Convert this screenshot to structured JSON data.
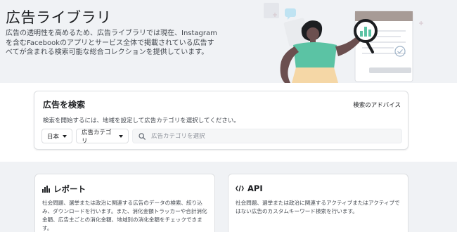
{
  "hero": {
    "title": "広告ライブラリ",
    "description": "広告の透明性を高めるため、広告ライブラリでは現在、Instagramを含むFacebookのアプリとサービス全体で掲載されている広告すべてが含まれる検索可能な総合コレクションを提供しています。"
  },
  "search": {
    "title": "広告を検索",
    "advice_link": "検索のアドバイス",
    "instruction": "検索を開始するには、地域を設定して広告カテゴリを選択してください。",
    "country": "日本",
    "category": "広告カテゴリ",
    "placeholder": "広告カテゴリを選択"
  },
  "cards": {
    "report": {
      "title": "レポート",
      "text": "社会問題、選挙または政治に関連する広告のデータの検索、絞り込み、ダウンロードを行います。また、消化金額トラッカーや合計消化金額、広告主ごとの消化金額、地域別の消化金額をチェックできます。"
    },
    "api": {
      "title": "API",
      "text": "社会問題、選挙または政治に関連するアクティブまたはアクティブではない広告のカスタムキーワード検索を行います。"
    }
  },
  "icons": [
    "bar-chart-icon",
    "code-icon",
    "search-icon",
    "magnifier-icon",
    "check-icon",
    "chat-bubble-icon"
  ],
  "colors": {
    "accent_teal": "#5bc3a4",
    "skin": "#6b4f4f",
    "pants": "#f5d7a6",
    "panel_brown": "#a79b96"
  }
}
